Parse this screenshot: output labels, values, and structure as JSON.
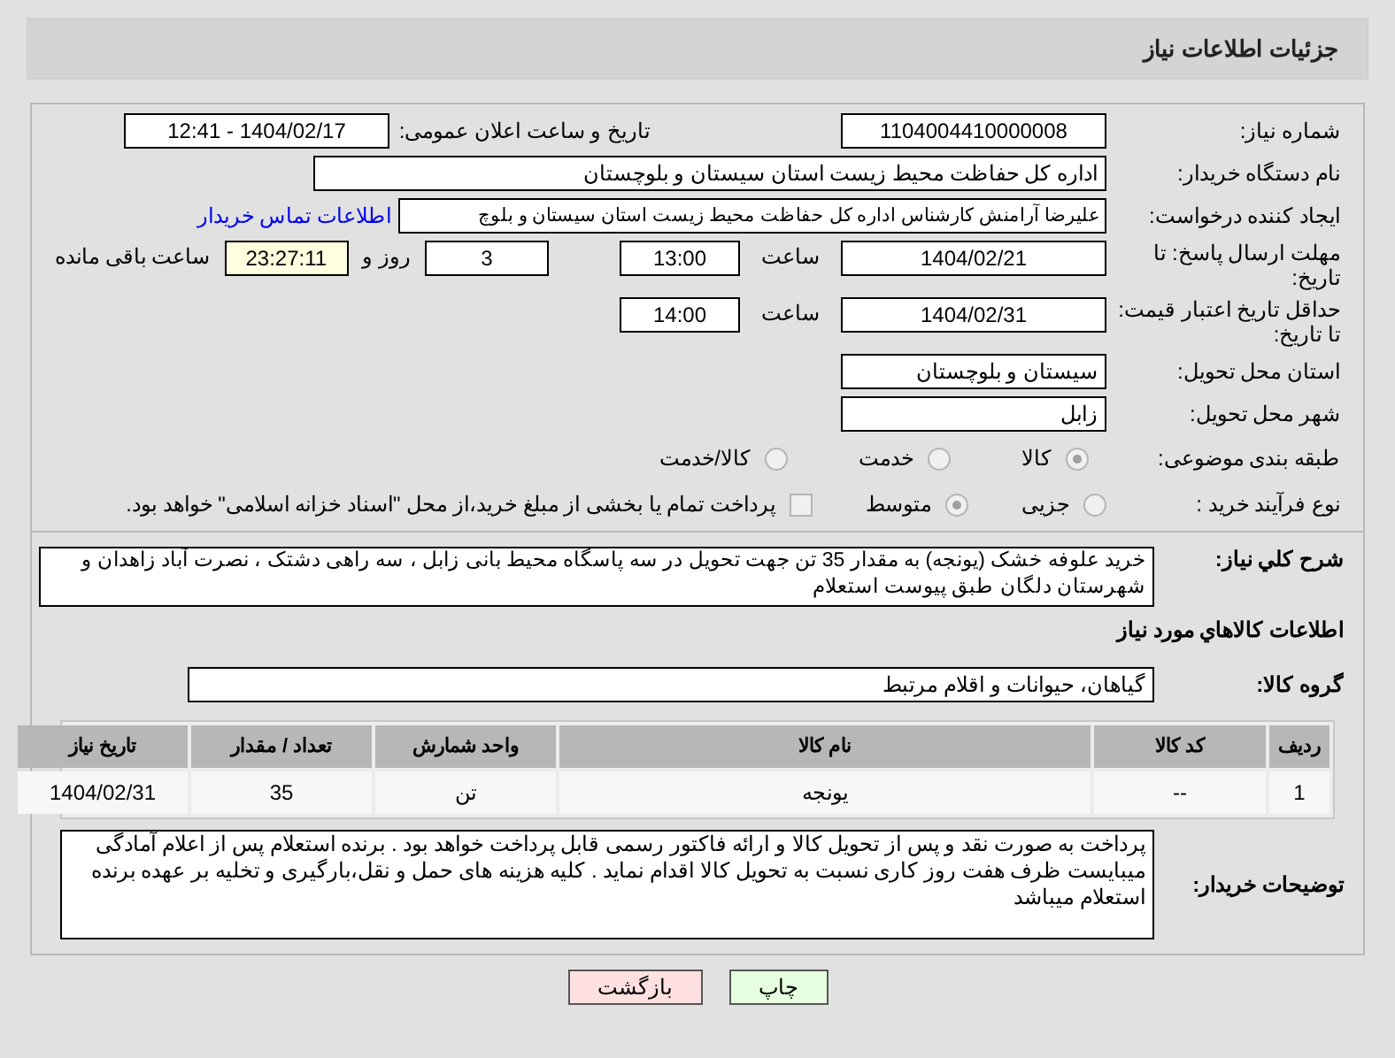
{
  "header": {
    "title": "جزئیات اطلاعات نیاز"
  },
  "need_number": {
    "label": "شماره نیاز:",
    "value": "1104004410000008"
  },
  "announce": {
    "label": "تاریخ و ساعت اعلان عمومی:",
    "value": "1404/02/17 - 12:41"
  },
  "buyer_org": {
    "label": "نام دستگاه خریدار:",
    "value": "اداره کل حفاظت محیط زیست استان سیستان و بلوچستان"
  },
  "creator": {
    "label": "ایجاد کننده درخواست:",
    "value": "علیرضا آرامنش کارشناس اداره کل حفاظت محیط زیست استان سیستان و بلوچ",
    "link": "اطلاعات تماس خریدار"
  },
  "deadline": {
    "label": "مهلت ارسال پاسخ: تا تاریخ:",
    "date": "1404/02/21",
    "time_label": "ساعت",
    "time": "13:00",
    "days": "3",
    "days_label": "روز و",
    "remaining": "23:27:11",
    "remaining_label": "ساعت باقی مانده"
  },
  "validity": {
    "label": "حداقل تاریخ اعتبار قیمت: تا تاریخ:",
    "date": "1404/02/31",
    "time_label": "ساعت",
    "time": "14:00"
  },
  "province": {
    "label": "استان محل تحویل:",
    "value": "سیستان و بلوچستان"
  },
  "city": {
    "label": "شهر محل تحویل:",
    "value": "زابل"
  },
  "category": {
    "label": "طبقه بندی موضوعی:",
    "options": [
      {
        "label": "کالا",
        "selected": true
      },
      {
        "label": "خدمت",
        "selected": false
      },
      {
        "label": "کالا/خدمت",
        "selected": false
      }
    ]
  },
  "process": {
    "label": "نوع فرآیند خرید :",
    "options": [
      {
        "label": "جزیی",
        "selected": false
      },
      {
        "label": "متوسط",
        "selected": true
      }
    ],
    "treasury": {
      "checked": false,
      "label": "پرداخت تمام یا بخشی از مبلغ خرید،از محل \"اسناد خزانه اسلامی\" خواهد بود."
    }
  },
  "description": {
    "label": "شرح کلي نياز:",
    "value": "خرید علوفه خشک (یونجه) به مقدار 35 تن جهت تحویل در سه پاسگاه محیط بانی زابل ، سه راهی دشتک ، نصرت آباد زاهدان و شهرستان دلگان طبق پیوست استعلام"
  },
  "goods_title": "اطلاعات کالاهاي مورد نياز",
  "goods_group": {
    "label": "گروه کالا:",
    "value": "گیاهان، حیوانات و اقلام مرتبط"
  },
  "table": {
    "columns": [
      "ردیف",
      "کد کالا",
      "نام کالا",
      "واحد شمارش",
      "تعداد / مقدار",
      "تاریخ نیاز"
    ],
    "rows": [
      [
        "1",
        "--",
        "یونجه",
        "تن",
        "35",
        "1404/02/31"
      ]
    ]
  },
  "notes": {
    "label": "توضیحات خریدار:",
    "value": "پرداخت به صورت نقد و پس از تحویل کالا و ارائه فاکتور رسمی قابل پرداخت خواهد بود . برنده استعلام پس از اعلام آمادگی میبایست ظرف هفت روز کاری نسبت به تحویل کالا اقدام نماید . کلیه هزینه های حمل و نقل،بارگیری و تخلیه بر عهده برنده استعلام میباشد"
  },
  "buttons": [
    {
      "kind": "print",
      "label": "چاپ"
    },
    {
      "kind": "back",
      "label": "بازگشت"
    }
  ]
}
